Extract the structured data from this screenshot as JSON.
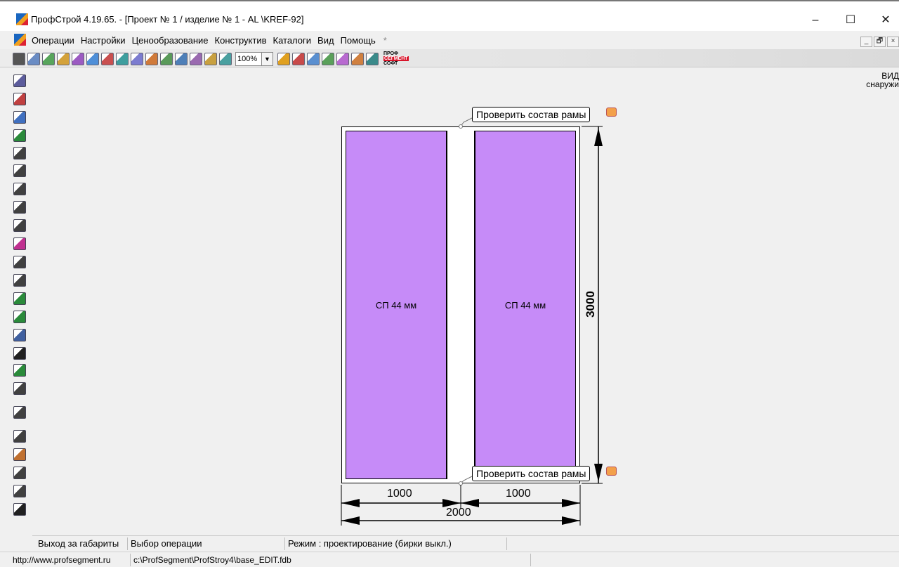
{
  "window": {
    "title": "ПрофСтрой 4.19.65. - [Проект № 1 / изделие № 1  -  AL \\KREF-92]",
    "controls": {
      "minimize": "–",
      "maximize": "☐",
      "close": "✕"
    }
  },
  "menu": {
    "items": [
      "Операции",
      "Настройки",
      "Ценообразование",
      "Конструктив",
      "Каталоги",
      "Вид",
      "Помощь"
    ],
    "extra": "*",
    "mdi_controls": [
      "_",
      "🗗",
      "×"
    ]
  },
  "toolbar": {
    "zoom": "100%",
    "zoom_arrow": "▼",
    "brand": [
      "ПРОФ",
      "СЕГМЕНТ",
      "СОФТ"
    ],
    "icon_colors": [
      "#6a8cc4",
      "#58a55c",
      "#d4a23b",
      "#9c5bc2",
      "#4f8fd8",
      "#c94f4f",
      "#3e9e9e",
      "#7c7cd0",
      "#d07a3a",
      "#5a9a5a",
      "#4e7fb8",
      "#9a6ab0",
      "#c8a040",
      "#4aa0a0"
    ],
    "icon_colors_right": [
      "#e0a020",
      "#c84a4a",
      "#5a8fd0",
      "#5aa05a",
      "#b86ad0",
      "#d08040",
      "#3a8a8a"
    ]
  },
  "view_label": [
    "ВИД",
    "снаружи"
  ],
  "left_tools": [
    "calculator-icon",
    "frame-icon",
    "horizontal-split-icon",
    "green-frame-icon",
    "impost-icon",
    "impost-t-icon",
    "door-icon",
    "grid-icon",
    "profile-icon",
    "star-icon",
    "arch-icon",
    "triangle-icon",
    "connector-icon",
    "layout-icon",
    "spring-icon",
    "dark-square-icon",
    "lines-icon",
    "glass-grid-icon",
    "cross-icon",
    "table-icon",
    "chart-icon",
    "doc-icon",
    "list-icon",
    "trash-icon"
  ],
  "drawing": {
    "panels": [
      {
        "label": "СП 44 мм"
      },
      {
        "label": "СП 44 мм"
      }
    ],
    "tags": [
      "Проверить состав рамы",
      "Проверить состав рамы"
    ],
    "dimensions": {
      "left_width": "1000",
      "right_width": "1000",
      "total_width": "2000",
      "height": "3000"
    }
  },
  "status": {
    "cell1": "Выход за габариты",
    "cell2": "Выбор операции",
    "cell3": "Режим : проектирование  (бирки выкл.)",
    "url": "http://www.profsegment.ru",
    "db_path": "c:\\ProfSegment\\ProfStroy4\\base_EDIT.fdb"
  },
  "colors": {
    "panel_fill": "#c68bf8",
    "tag_badge": "#f3a04a",
    "brand_red": "#d8152b"
  }
}
